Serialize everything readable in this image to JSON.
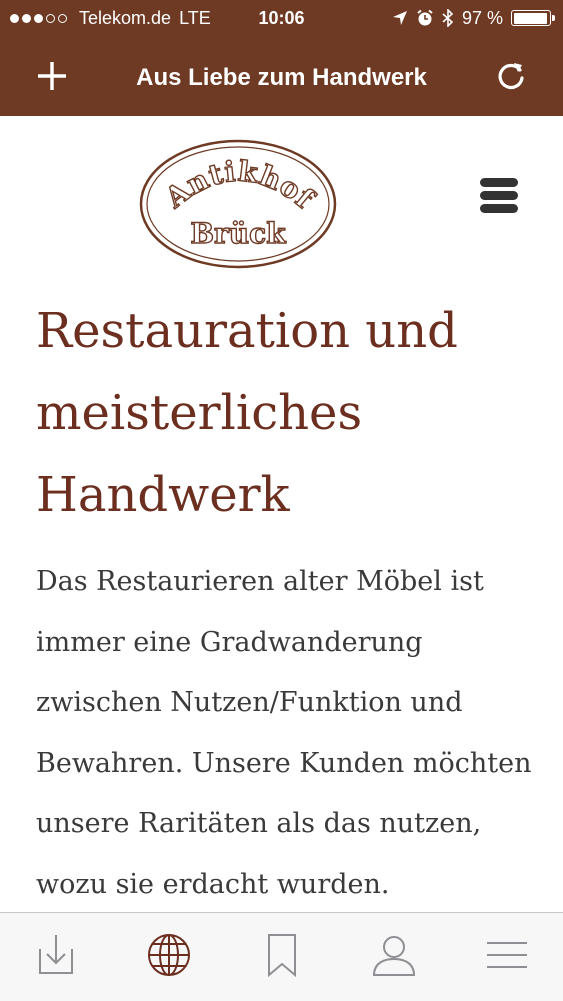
{
  "status_bar": {
    "carrier": "Telekom.de",
    "network": "LTE",
    "time": "10:06",
    "battery_percent": "97 %",
    "signal_bars_filled": 3,
    "signal_bars_total": 5,
    "battery_level": 0.97,
    "icons": [
      "location-arrow-icon",
      "alarm-icon",
      "bluetooth-icon",
      "battery-icon"
    ]
  },
  "nav": {
    "title": "Aus Liebe zum Handwerk",
    "left_icon": "plus-icon",
    "right_icon": "reload-icon"
  },
  "site": {
    "logo_line1": "Antikhof",
    "logo_line2": "Brück",
    "menu_icon": "hamburger-menu-icon",
    "headline": "Restauration und meisterliches Handwerk",
    "body": "Das Restaurieren alter Möbel ist immer eine Gradwanderung zwischen Nutzen/Funktion und Bewahren. Unsere Kunden möchten unsere Raritäten als das nutzen, wozu sie erdacht wurden."
  },
  "tabbar": {
    "items": [
      "download-icon",
      "globe-icon",
      "bookmark-icon",
      "profile-icon",
      "menu-icon"
    ]
  },
  "colors": {
    "brand_brown": "#6e3a24",
    "headline": "#6b2e1f",
    "text": "#3a3a3a",
    "tab_icon": "#8e8e93",
    "tab_active": "#6b2e1f"
  }
}
